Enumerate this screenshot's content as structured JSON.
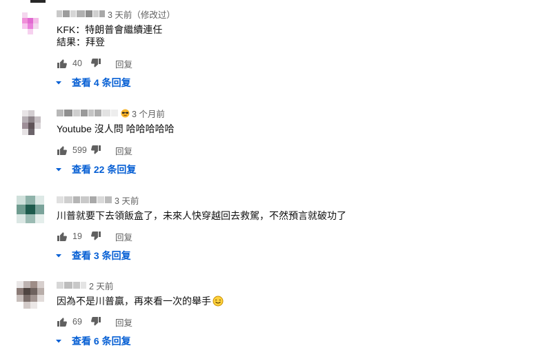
{
  "comments": [
    {
      "time": "3 天前（修改过）",
      "lines": [
        "KFK：特朗普會繼續連任",
        "結果：拜登"
      ],
      "likes": "40",
      "reply_label": "回复",
      "view_replies": "查看 4 条回复"
    },
    {
      "time": "3 个月前",
      "lines": [
        "Youtube 沒人問 哈哈哈哈哈"
      ],
      "likes": "599",
      "reply_label": "回复",
      "view_replies": "查看 22 条回复"
    },
    {
      "time": "3 天前",
      "lines": [
        "川普就要下去領飯盒了，未來人快穿越回去救駕，不然預言就破功了"
      ],
      "likes": "19",
      "reply_label": "回复",
      "view_replies": "查看 3 条回复"
    },
    {
      "time": "2 天前",
      "lines": [
        "因為不是川普贏，再來看一次的舉手"
      ],
      "likes": "69",
      "reply_label": "回复",
      "view_replies": "查看 6 条回复"
    }
  ],
  "icons": {
    "like": "thumbs-up-icon",
    "dislike": "thumbs-down-icon",
    "expand": "caret-down-icon",
    "sunglasses": "sunglasses-emoji-icon",
    "smile": "smiling-face-emoji-icon"
  },
  "colors": {
    "link_blue": "#065fd4",
    "secondary_text": "#606060",
    "text": "#0f0f0f"
  }
}
